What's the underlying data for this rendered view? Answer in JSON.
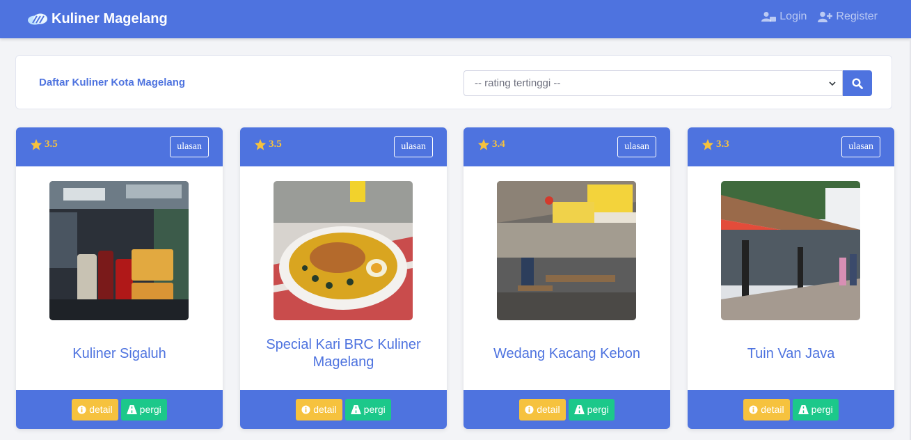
{
  "brand": {
    "title": "Kuliner Magelang",
    "icon": "cloud-logo-icon"
  },
  "nav": {
    "login": "Login",
    "register": "Register"
  },
  "filter": {
    "title": "Daftar Kuliner Kota Magelang",
    "select_value": "-- rating tertinggi --",
    "search_icon": "search-icon"
  },
  "cards": [
    {
      "rating": "3.5",
      "ulasan": "ulasan",
      "title": "Kuliner Sigaluh",
      "detail": "detail",
      "pergi": "pergi"
    },
    {
      "rating": "3.5",
      "ulasan": "ulasan",
      "title": "Special Kari BRC Kuliner Magelang",
      "detail": "detail",
      "pergi": "pergi"
    },
    {
      "rating": "3.4",
      "ulasan": "ulasan",
      "title": "Wedang Kacang Kebon",
      "detail": "detail",
      "pergi": "pergi"
    },
    {
      "rating": "3.3",
      "ulasan": "ulasan",
      "title": "Tuin Van Java",
      "detail": "detail",
      "pergi": "pergi"
    }
  ],
  "colors": {
    "primary": "#4e73df",
    "warning": "#f6c23e",
    "success": "#1cc88a"
  }
}
